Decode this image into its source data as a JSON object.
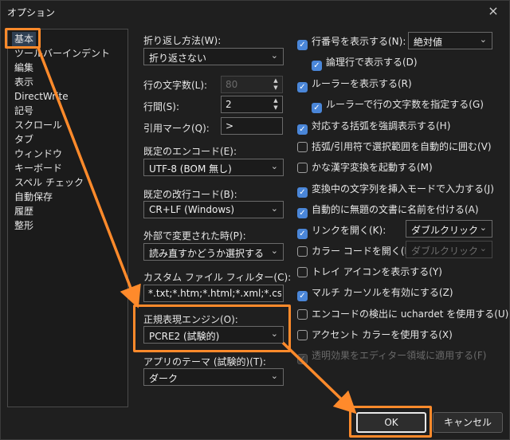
{
  "window": {
    "title": "オプション",
    "close_icon": "×"
  },
  "categories": [
    "基本",
    "ツールバー・インデント",
    "編集",
    "表示",
    "DirectWrite",
    "記号",
    "スクロール",
    "タブ",
    "ウィンドウ",
    "キーボード",
    "スペル チェック",
    "自動保存",
    "履歴",
    "整形"
  ],
  "categories_display": [
    "基本",
    "ツールバーインデント",
    "編集",
    "表示",
    "DirectWrite",
    "記号",
    "スクロール",
    "タブ",
    "ウィンドウ",
    "キーボード",
    "スペル チェック",
    "自動保存",
    "履歴",
    "整形"
  ],
  "left": {
    "wrap_label": "折り返し方法(W):",
    "wrap_value": "折り返さない",
    "chars_label": "行の文字数(L):",
    "chars_value": "80",
    "spacing_label": "行間(S):",
    "spacing_value": "2",
    "quote_label": "引用マーク(Q):",
    "quote_value": ">",
    "encoding_label": "既定のエンコード(E):",
    "encoding_value": "UTF-8 (BOM 無し)",
    "newline_label": "既定の改行コード(B):",
    "newline_value": "CR+LF (Windows)",
    "external_label": "外部で変更された時(P):",
    "external_value": "読み直すかどうか選択する",
    "filter_label": "カスタム ファイル フィルター(C):",
    "filter_value": "*.txt;*.htm;*.html;*.xml;*.css;*.js",
    "regex_label": "正規表現エンジン(O):",
    "regex_value": "PCRE2 (試験的)",
    "theme_label": "アプリのテーマ (試験的)(T):",
    "theme_value": "ダーク"
  },
  "right": {
    "line_numbers": "行番号を表示する(N):",
    "line_numbers_mode": "絶対値",
    "logical_lines": "論理行で表示する(D)",
    "ruler": "ルーラーを表示する(R)",
    "ruler_chars": "ルーラーで行の文字数を指定する(G)",
    "brackets": "対応する括弧を強調表示する(H)",
    "auto_enclose": "括弧/引用符で選択範囲を自動的に囲む(V)",
    "kanji": "かな漢字変換を起動する(M)",
    "insert_mode": "変換中の文字列を挿入モードで入力する(J)",
    "auto_name": "自動的に無題の文書に名前を付ける(A)",
    "open_link": "リンクを開く(K):",
    "open_link_mode": "ダブルクリック",
    "color_code": "カラー コードを開く(I):",
    "color_code_mode": "ダブルクリック",
    "tray": "トレイ アイコンを表示する(Y)",
    "multi_cursor": "マルチ カーソルを有効にする(Z)",
    "uchardet": "エンコードの検出に uchardet を使用する(U)",
    "accent": "アクセント カラーを使用する(X)",
    "transparency": "透明効果をエディター領域に適用する(F)"
  },
  "buttons": {
    "ok": "OK",
    "cancel": "キャンセル"
  },
  "annotation_color": "#ff8a2b",
  "check_glyph": "✓",
  "dropdown_glyph": "⌄",
  "spin_up": "▲",
  "spin_down": "▼"
}
